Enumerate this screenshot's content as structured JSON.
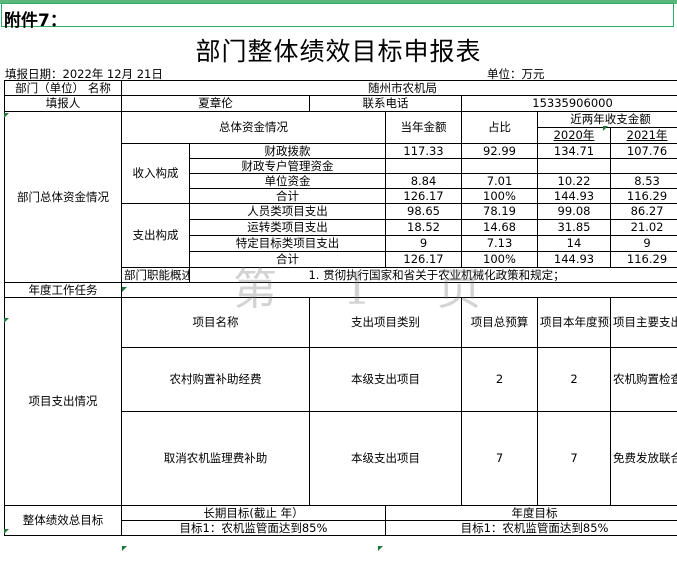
{
  "annex": "附件7：",
  "title": "部门整体绩效目标申报表",
  "fill_date_label": "填报日期：",
  "fill_date": "2022年 12月 21日",
  "unit_label": "单位：",
  "unit_value": "万元",
  "watermark": "第 1 页",
  "row_dept": {
    "label": "部门（单位） 名称",
    "value": "随州市农机局"
  },
  "row_filler": {
    "label": "填报人",
    "name": "夏章伦",
    "phone_label": "联系电话",
    "phone": "15335906000"
  },
  "fund": {
    "section_label": "部门总体资金情况",
    "overall_label": "总体资金情况",
    "col_current": "当年金额",
    "col_ratio": "占比",
    "col_recent": "近两年收支金额",
    "col_2020": "2020年",
    "col_2021": "2021年",
    "income_label": "收入构成",
    "income_rows": [
      {
        "name": "财政拨款",
        "amount": "117.33",
        "ratio": "92.99",
        "y2020": "134.71",
        "y2021": "107.76"
      },
      {
        "name": "财政专户管理资金",
        "amount": "",
        "ratio": "",
        "y2020": "",
        "y2021": ""
      },
      {
        "name": "单位资金",
        "amount": "8.84",
        "ratio": "7.01",
        "y2020": "10.22",
        "y2021": "8.53"
      },
      {
        "name": "合计",
        "amount": "126.17",
        "ratio": "100%",
        "y2020": "144.93",
        "y2021": "116.29"
      }
    ],
    "expense_label": "支出构成",
    "expense_rows": [
      {
        "name": "人员类项目支出",
        "amount": "98.65",
        "ratio": "78.19",
        "y2020": "99.08",
        "y2021": "86.27"
      },
      {
        "name": "运转类项目支出",
        "amount": "18.52",
        "ratio": "14.68",
        "y2020": "31.85",
        "y2021": "21.02"
      },
      {
        "name": "特定目标类项目支出",
        "amount": "9",
        "ratio": "7.13",
        "y2020": "14",
        "y2021": "9"
      },
      {
        "name": "合计",
        "amount": "126.17",
        "ratio": "100%",
        "y2020": "144.93",
        "y2021": "116.29"
      }
    ]
  },
  "duty": {
    "label": "部门职能概述",
    "value": "1. 贯彻执行国家和省关于农业机械化政策和规定；"
  },
  "annual_task": {
    "label": "年度工作任务",
    "value": ""
  },
  "projects": {
    "section_label": "项目支出情况",
    "headers": {
      "name": "项目名称",
      "category": "支出项目类别",
      "total": "项目总预算",
      "annual": "项目本年度预算",
      "purpose": "项目主要支出方向和用途"
    },
    "rows": [
      {
        "name": "农村购置补助经费",
        "category": "本级支出项目",
        "total": "2",
        "annual": "2",
        "purpose": "农机购置检查、核查、绩效考核、宣传"
      },
      {
        "name": "取消农机监理费补助",
        "category": "本级支出项目",
        "total": "7",
        "annual": "7",
        "purpose": "免费发放联合收割机、拖拉机号牌、证件及农业机械安全检验费等"
      }
    ]
  },
  "goals": {
    "label": "整体绩效总目标",
    "long_term_label": "长期目标(截止    年）",
    "annual_label": "年度目标",
    "long_term_value": "目标1：农机监管面达到85%",
    "annual_value": "目标1：农机监管面达到85%"
  }
}
